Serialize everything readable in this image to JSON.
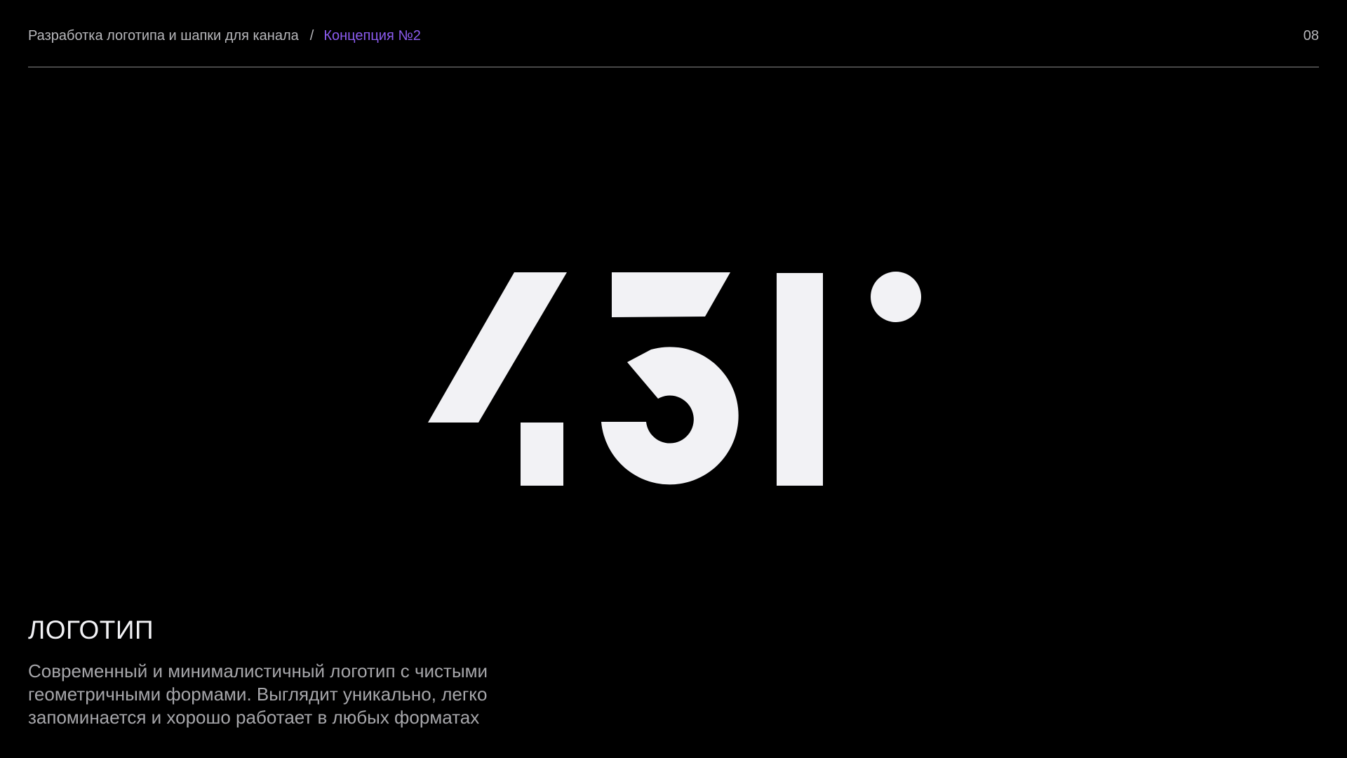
{
  "header": {
    "project_title": "Разработка логотипа и шапки для канала",
    "separator": "/",
    "current_section": "Концепция №2",
    "page_number": "08"
  },
  "logo": {
    "mark_color": "#f2f2f5",
    "description_alt": "451°"
  },
  "content": {
    "title": "ЛОГОТИП",
    "description": "Современный и минималистичный логотип с чистыми геометричными формами. Выглядит уникально, легко запоминается и хорошо работает в любых форматах"
  },
  "colors": {
    "background": "#000000",
    "accent": "#8c5cf0",
    "text_primary": "#f2f2f5",
    "text_secondary": "#a6a6aa"
  }
}
